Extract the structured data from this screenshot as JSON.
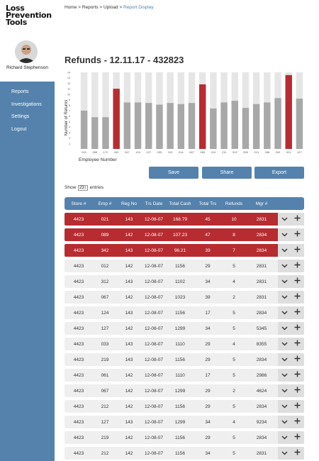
{
  "sidebar": {
    "logo_lines": [
      "Loss",
      "Prevention",
      "Tools"
    ],
    "user_name": "Richard Stephenson",
    "items": [
      {
        "label": "Reports"
      },
      {
        "label": "Investigations"
      },
      {
        "label": "Settings"
      },
      {
        "label": "Logout"
      }
    ]
  },
  "breadcrumb": {
    "items": [
      "Home",
      "Reports",
      "Upload"
    ],
    "separator": ">",
    "current": "Report Display"
  },
  "page_title": "Refunds - 12.11.17 - 432823",
  "chart_data": {
    "type": "bar",
    "ylabel": "Number of Returns",
    "xlabel": "Employee Number",
    "ylim": [
      0,
      14
    ],
    "yticks": [
      1,
      2,
      3,
      4,
      5,
      6,
      7,
      8,
      9,
      10,
      11,
      12,
      13,
      14
    ],
    "categories": [
      "021",
      "089",
      "172",
      "342",
      "047",
      "124",
      "127",
      "033",
      "312",
      "014",
      "067",
      "089",
      "219",
      "211",
      "313",
      "028",
      "213",
      "346",
      "042",
      "021",
      "127"
    ],
    "values": [
      7,
      5.8,
      5.8,
      11,
      8.5,
      8.5,
      8.4,
      8.1,
      8.4,
      8.2,
      8.4,
      11.8,
      7.4,
      8.5,
      8.8,
      7.5,
      8.2,
      8.5,
      9.3,
      13.5,
      9.2
    ],
    "highlighted": [
      "342",
      "089",
      "021"
    ],
    "highlighted_indices": [
      3,
      11,
      19
    ],
    "colors": {
      "bar": "#a8a8a8",
      "highlight": "#b72c31",
      "track": "#e6e6e6"
    }
  },
  "buttons": {
    "save": "Save",
    "share": "Share",
    "export": "Export"
  },
  "entries": {
    "show": "Show",
    "value": "23",
    "suffix": "entries"
  },
  "table": {
    "headers": [
      "Store #",
      "Emp #",
      "Reg No",
      "Trs Date",
      "Total Cash",
      "Total Trs",
      "Refunds",
      "Mgr #"
    ],
    "rows": [
      {
        "cells": [
          "4423",
          "021",
          "143",
          "12-08-07",
          "168.79",
          "45",
          "10",
          "2831"
        ],
        "flag": true
      },
      {
        "cells": [
          "4423",
          "089",
          "142",
          "12-08-07",
          "107.23",
          "47",
          "8",
          "2834"
        ],
        "flag": true
      },
      {
        "cells": [
          "4423",
          "342",
          "143",
          "12-08-07",
          "96.21",
          "39",
          "7",
          "2834"
        ],
        "flag": true
      },
      {
        "cells": [
          "4423",
          "012",
          "142",
          "12-08-07",
          "1156",
          "29",
          "5",
          "2831"
        ],
        "flag": false
      },
      {
        "cells": [
          "4423",
          "312",
          "143",
          "12-08-07",
          "1102",
          "34",
          "4",
          "2831"
        ],
        "flag": false
      },
      {
        "cells": [
          "4423",
          "067",
          "142",
          "12-08-07",
          "1023",
          "39",
          "2",
          "2831"
        ],
        "flag": false
      },
      {
        "cells": [
          "4423",
          "124",
          "143",
          "12-08-07",
          "1156",
          "17",
          "5",
          "2834"
        ],
        "flag": false
      },
      {
        "cells": [
          "4423",
          "127",
          "142",
          "12-08-07",
          "1299",
          "34",
          "5",
          "5345"
        ],
        "flag": false
      },
      {
        "cells": [
          "4423",
          "033",
          "143",
          "12-08-07",
          "1110",
          "29",
          "4",
          "8355"
        ],
        "flag": false
      },
      {
        "cells": [
          "4423",
          "219",
          "143",
          "12-08-07",
          "1156",
          "29",
          "5",
          "2834"
        ],
        "flag": false
      },
      {
        "cells": [
          "4423",
          "061",
          "142",
          "12-08-07",
          "1110",
          "17",
          "5",
          "2986"
        ],
        "flag": false
      },
      {
        "cells": [
          "4423",
          "067",
          "142",
          "12-08-07",
          "1299",
          "29",
          "2",
          "4624"
        ],
        "flag": false
      },
      {
        "cells": [
          "4423",
          "212",
          "142",
          "12-08-07",
          "1156",
          "29",
          "5",
          "2834"
        ],
        "flag": false
      },
      {
        "cells": [
          "4423",
          "127",
          "143",
          "12-08-07",
          "1299",
          "34",
          "4",
          "9234"
        ],
        "flag": false
      },
      {
        "cells": [
          "4423",
          "219",
          "142",
          "12-08-07",
          "1156",
          "29",
          "5",
          "2834"
        ],
        "flag": false
      },
      {
        "cells": [
          "4423",
          "212",
          "142",
          "12-08-07",
          "1156",
          "34",
          "5",
          "2831"
        ],
        "flag": false
      }
    ],
    "action_icons": [
      "chevron-down-icon",
      "plus-icon"
    ]
  }
}
